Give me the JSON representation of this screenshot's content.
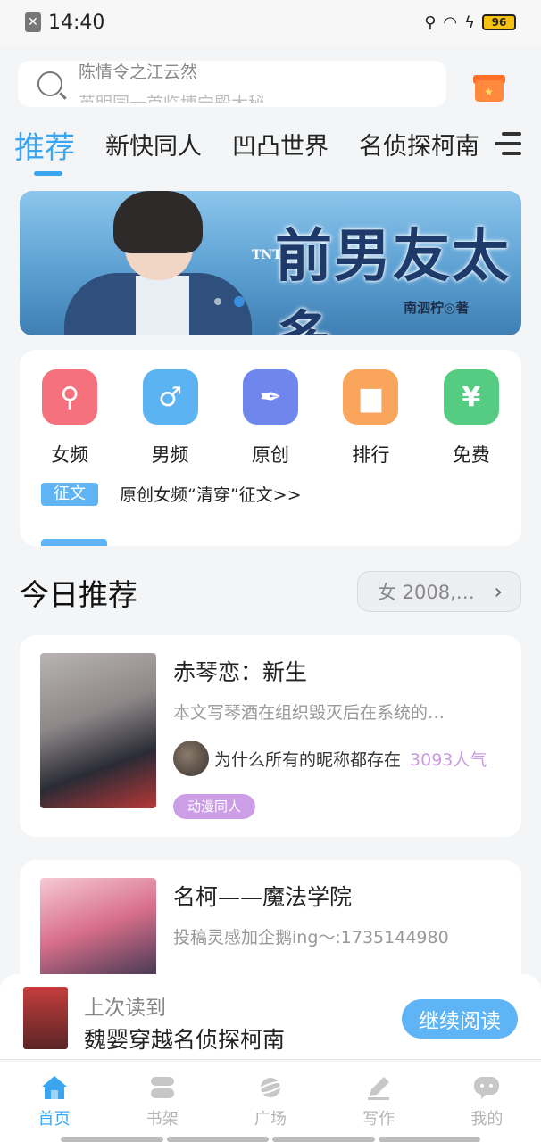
{
  "status_bar": {
    "time": "14:40",
    "battery": "96"
  },
  "search": {
    "line1": "陈情令之江云然",
    "line2": "英明同一首临博宁殿大秘"
  },
  "tabs": [
    "推荐",
    "新快同人",
    "凹凸世界",
    "名侦探柯南"
  ],
  "banner": {
    "title": "前男友太多",
    "tag": "TNT",
    "author": "南泗柠◎著"
  },
  "categories": [
    {
      "label": "女频",
      "icon": "female-icon",
      "color": "#f4717d"
    },
    {
      "label": "男频",
      "icon": "male-icon",
      "color": "#5cb3f2"
    },
    {
      "label": "原创",
      "icon": "pen-nib-icon",
      "color": "#6f86ec"
    },
    {
      "label": "排行",
      "icon": "ranking-icon",
      "color": "#f9a55c"
    },
    {
      "label": "免费",
      "icon": "yen-icon",
      "color": "#56cc83"
    }
  ],
  "notice": {
    "tag": "征文",
    "text": "原创女频“清穿”征文>>"
  },
  "today": {
    "title": "今日推荐",
    "filter": "女 2008,…"
  },
  "books": [
    {
      "title": "赤琴恋：新生",
      "desc": "本文写琴酒在组织毁灭后在系统的…",
      "author": "为什么所有的昵称都存在",
      "popularity": "3093人气",
      "tag": "动漫同人"
    },
    {
      "title": "名柯——魔法学院",
      "desc": "投稿灵感加企鹅ing～:1735144980"
    }
  ],
  "continue_reading": {
    "label": "上次读到",
    "book": "魏婴穿越名侦探柯南",
    "button": "继续阅读"
  },
  "nav": [
    {
      "label": "首页",
      "icon": "home-icon",
      "active": true
    },
    {
      "label": "书架",
      "icon": "bookshelf-icon"
    },
    {
      "label": "广场",
      "icon": "planet-icon"
    },
    {
      "label": "写作",
      "icon": "write-icon"
    },
    {
      "label": "我的",
      "icon": "profile-icon"
    }
  ],
  "colors": {
    "accent": "#3ba6f0",
    "tag_purple": "#cc9ee8",
    "popularity": "#c99be0"
  }
}
